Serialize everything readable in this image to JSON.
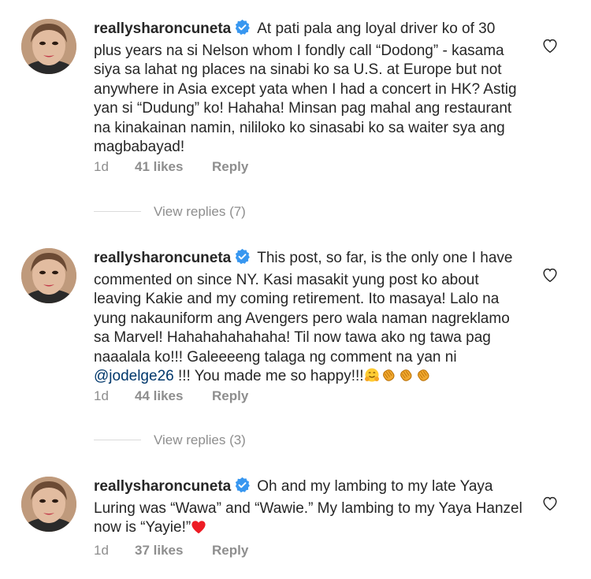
{
  "comments": [
    {
      "username": "reallysharoncuneta",
      "text": "At pati pala ang loyal driver ko of 30 plus years na si Nelson whom I fondly call “Dodong” - kasama siya sa lahat ng places na sinabi ko sa U.S. at Europe but not anywhere in Asia except yata when I had a concert in HK? Astig yan si “Dudung” ko! Hahaha! Minsan pag mahal ang restaurant na kinakainan namin, nililoko ko sinasabi ko sa waiter sya ang magbabayad!",
      "time": "1d",
      "likes": "41 likes",
      "reply": "Reply",
      "view_replies": "View replies (7)"
    },
    {
      "username": "reallysharoncuneta",
      "text_before": "This post, so far, is the only one I have commented on since NY. Kasi masakit yung post ko about leaving Kakie and my coming retirement. Ito masaya! Lalo na yung nakauniform ang Avengers pero wala naman nagreklamo sa Marvel! Hahahahahahaha! Til now tawa ako ng tawa pag naaalala ko!!! Galeeeeng talaga ng comment na yan ni ",
      "mention": "@jodelge26",
      "text_after": " !!! You made me so happy!!!",
      "emojis": [
        "hugging-face",
        "clapping-hands",
        "clapping-hands",
        "clapping-hands"
      ],
      "time": "1d",
      "likes": "44 likes",
      "reply": "Reply",
      "view_replies": "View replies (3)"
    },
    {
      "username": "reallysharoncuneta",
      "text": "Oh and my lambing to my late Yaya Luring was “Wawa” and “Wawie.” My lambing to my Yaya Hanzel now is “Yayie!”",
      "emojis": [
        "red-heart"
      ],
      "time": "1d",
      "likes": "37 likes",
      "reply": "Reply"
    }
  ],
  "colors": {
    "text": "#262626",
    "meta": "#8e8e8e",
    "verified": "#3897f0",
    "mention": "#00376b",
    "heart_emoji": "#ed1c24"
  }
}
